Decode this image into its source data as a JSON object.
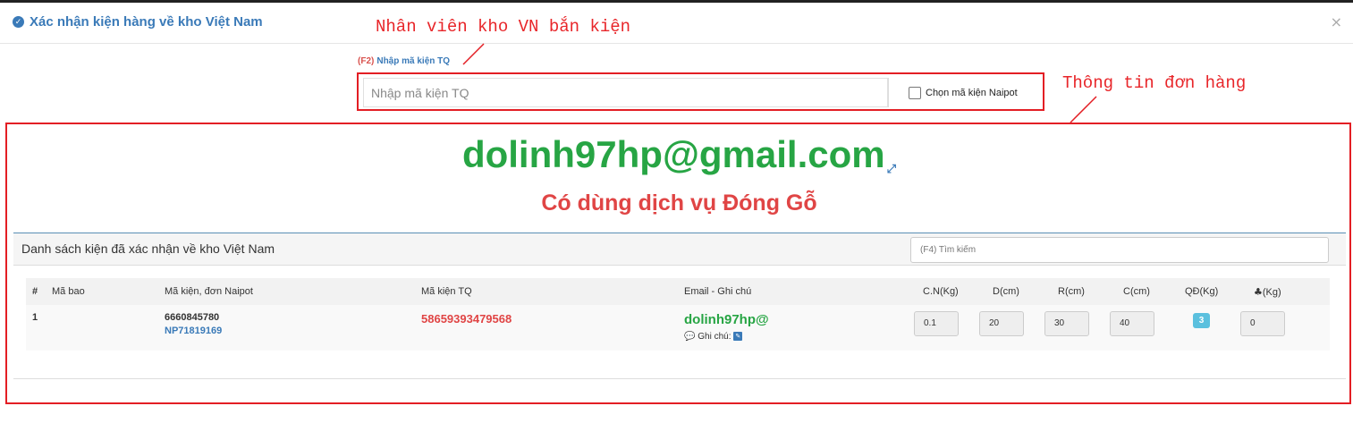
{
  "modal": {
    "title": "Xác nhận kiện hàng về kho Việt Nam",
    "close": "×"
  },
  "annotations": {
    "staff": "Nhân viên kho VN bắn kiện",
    "order_info": "Thông tin đơn hàng"
  },
  "scan": {
    "key": "(F2)",
    "label": "Nhập mã kiện TQ",
    "placeholder": "Nhập mã kiện TQ",
    "checkbox_label": "Chọn mã kiện Naipot"
  },
  "customer": {
    "email": "dolinh97hp@gmail.com",
    "service": "Có dùng dịch vụ Đóng Gỗ"
  },
  "list": {
    "title": "Danh sách kiện đã xác nhận về kho Việt Nam",
    "search_placeholder": "(F4) Tìm kiếm",
    "columns": [
      "#",
      "Mã bao",
      "Mã kiện, đơn Naipot",
      "Mã kiện TQ",
      "Email - Ghi chú",
      "C.N(Kg)",
      "D(cm)",
      "R(cm)",
      "C(cm)",
      "QĐ(Kg)",
      "(Kg)"
    ],
    "rows": [
      {
        "index": "1",
        "bag": "",
        "package_code": "6660845780",
        "naipot_order": "NP71819169",
        "cn_code": "58659393479568",
        "email": "dolinh97hp@",
        "note_label": "Ghi chú:",
        "weight": "0.1",
        "length": "20",
        "width": "30",
        "height": "40",
        "converted": "3",
        "extra": "0"
      }
    ]
  },
  "colors": {
    "accent": "#3a7ab8",
    "green": "#27a544",
    "red": "#e04545",
    "annotation": "#e31e24"
  }
}
